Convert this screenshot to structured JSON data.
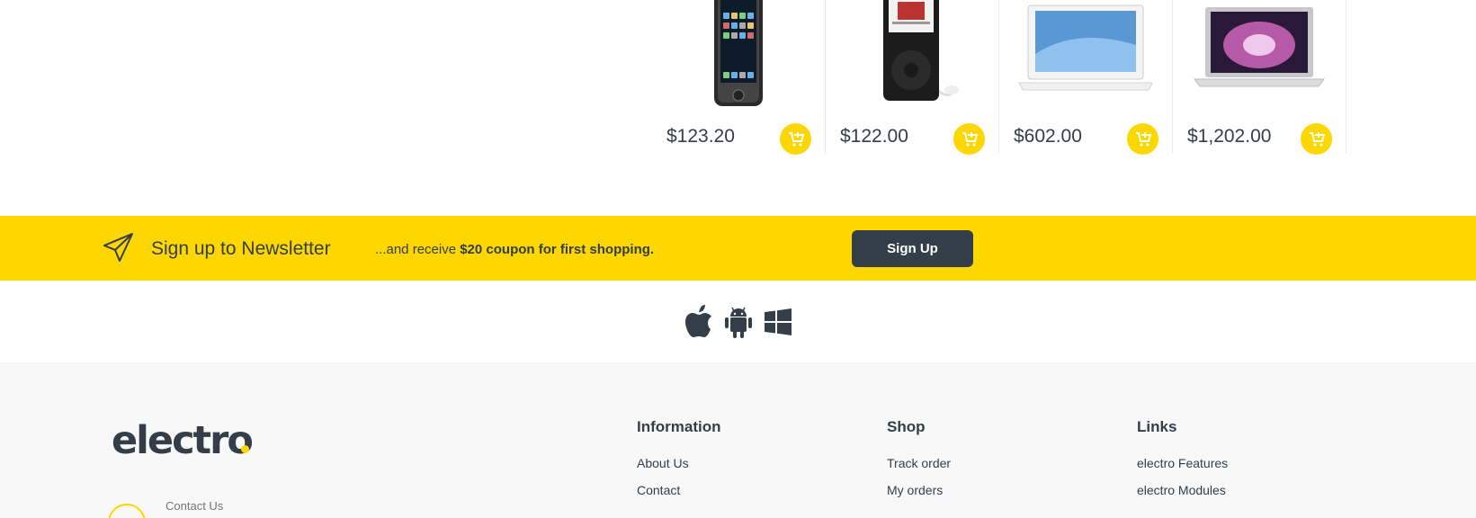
{
  "products": [
    {
      "price": "$123.20",
      "image": "iphone"
    },
    {
      "price": "$122.00",
      "image": "ipod"
    },
    {
      "price": "$602.00",
      "image": "macbook"
    },
    {
      "price": "$1,202.00",
      "image": "macbook-air"
    }
  ],
  "newsletter": {
    "title": "Sign up to Newsletter",
    "text_prefix": "...and receive ",
    "text_bold": "$20 coupon for first shopping.",
    "button_label": "Sign Up",
    "icon": "paper-plane-icon"
  },
  "platforms": [
    "apple-icon",
    "android-icon",
    "windows-icon"
  ],
  "footer": {
    "logo": "electro",
    "contact_label": "Contact Us",
    "columns": [
      {
        "title": "Information",
        "links": [
          "About Us",
          "Contact"
        ]
      },
      {
        "title": "Shop",
        "links": [
          "Track order",
          "My orders"
        ]
      },
      {
        "title": "Links",
        "links": [
          "electro Features",
          "electro Modules"
        ]
      }
    ]
  },
  "colors": {
    "accent": "#fed700",
    "dark": "#333e48",
    "footer_bg": "#f8f8f8"
  }
}
